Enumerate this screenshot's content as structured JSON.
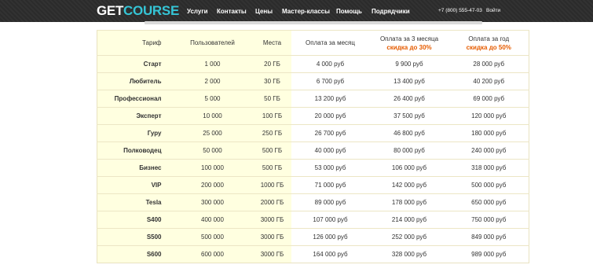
{
  "header": {
    "logo_part1": "GET",
    "logo_part2": "COURSE",
    "nav": [
      "Услуги",
      "Контакты",
      "Цены",
      "Мастер-классы",
      "Помощь",
      "Подрядчики"
    ],
    "phone": "+7 (800) 555-47-03",
    "login": "Войти"
  },
  "colors": {
    "topbar": "#2b2b2b",
    "logo_accent": "#35c5d6",
    "highlight_col": "#ffffe0",
    "discount": "#e65c00"
  },
  "table": {
    "headers": [
      "Тариф",
      "Пользователей",
      "Места",
      "Оплата за месяц",
      "Оплата за 3 месяца",
      "Оплата за год"
    ],
    "header_discounts": [
      "",
      "",
      "",
      "",
      "скидка до 30%",
      "скидка до 50%"
    ],
    "rows": [
      [
        "Старт",
        "1 000",
        "20 ГБ",
        "4 000 руб",
        "9 900 руб",
        "28 000 руб"
      ],
      [
        "Любитель",
        "2 000",
        "30 ГБ",
        "6 700 руб",
        "13 400 руб",
        "40 200 руб"
      ],
      [
        "Профессионал",
        "5 000",
        "50 ГБ",
        "13 200 руб",
        "26 400 руб",
        "69 000 руб"
      ],
      [
        "Эксперт",
        "10 000",
        "100 ГБ",
        "20 000 руб",
        "37 500 руб",
        "120 000 руб"
      ],
      [
        "Гуру",
        "25 000",
        "250 ГБ",
        "26 700 руб",
        "46 800 руб",
        "180 000 руб"
      ],
      [
        "Полководец",
        "50 000",
        "500 ГБ",
        "40 000 руб",
        "80 000 руб",
        "240 000 руб"
      ],
      [
        "Бизнес",
        "100 000",
        "500 ГБ",
        "53 000 руб",
        "106 000 руб",
        "318 000 руб"
      ],
      [
        "VIP",
        "200 000",
        "1000 ГБ",
        "71 000 руб",
        "142 000 руб",
        "500 000 руб"
      ],
      [
        "Tesla",
        "300 000",
        "2000 ГБ",
        "89 000 руб",
        "178 000 руб",
        "650 000 руб"
      ],
      [
        "S400",
        "400 000",
        "3000 ГБ",
        "107 000 руб",
        "214 000 руб",
        "750 000 руб"
      ],
      [
        "S500",
        "500 000",
        "3000 ГБ",
        "126 000 руб",
        "252 000 руб",
        "849 000 руб"
      ],
      [
        "S600",
        "600 000",
        "3000 ГБ",
        "164 000 руб",
        "328 000 руб",
        "989 000 руб"
      ]
    ]
  }
}
